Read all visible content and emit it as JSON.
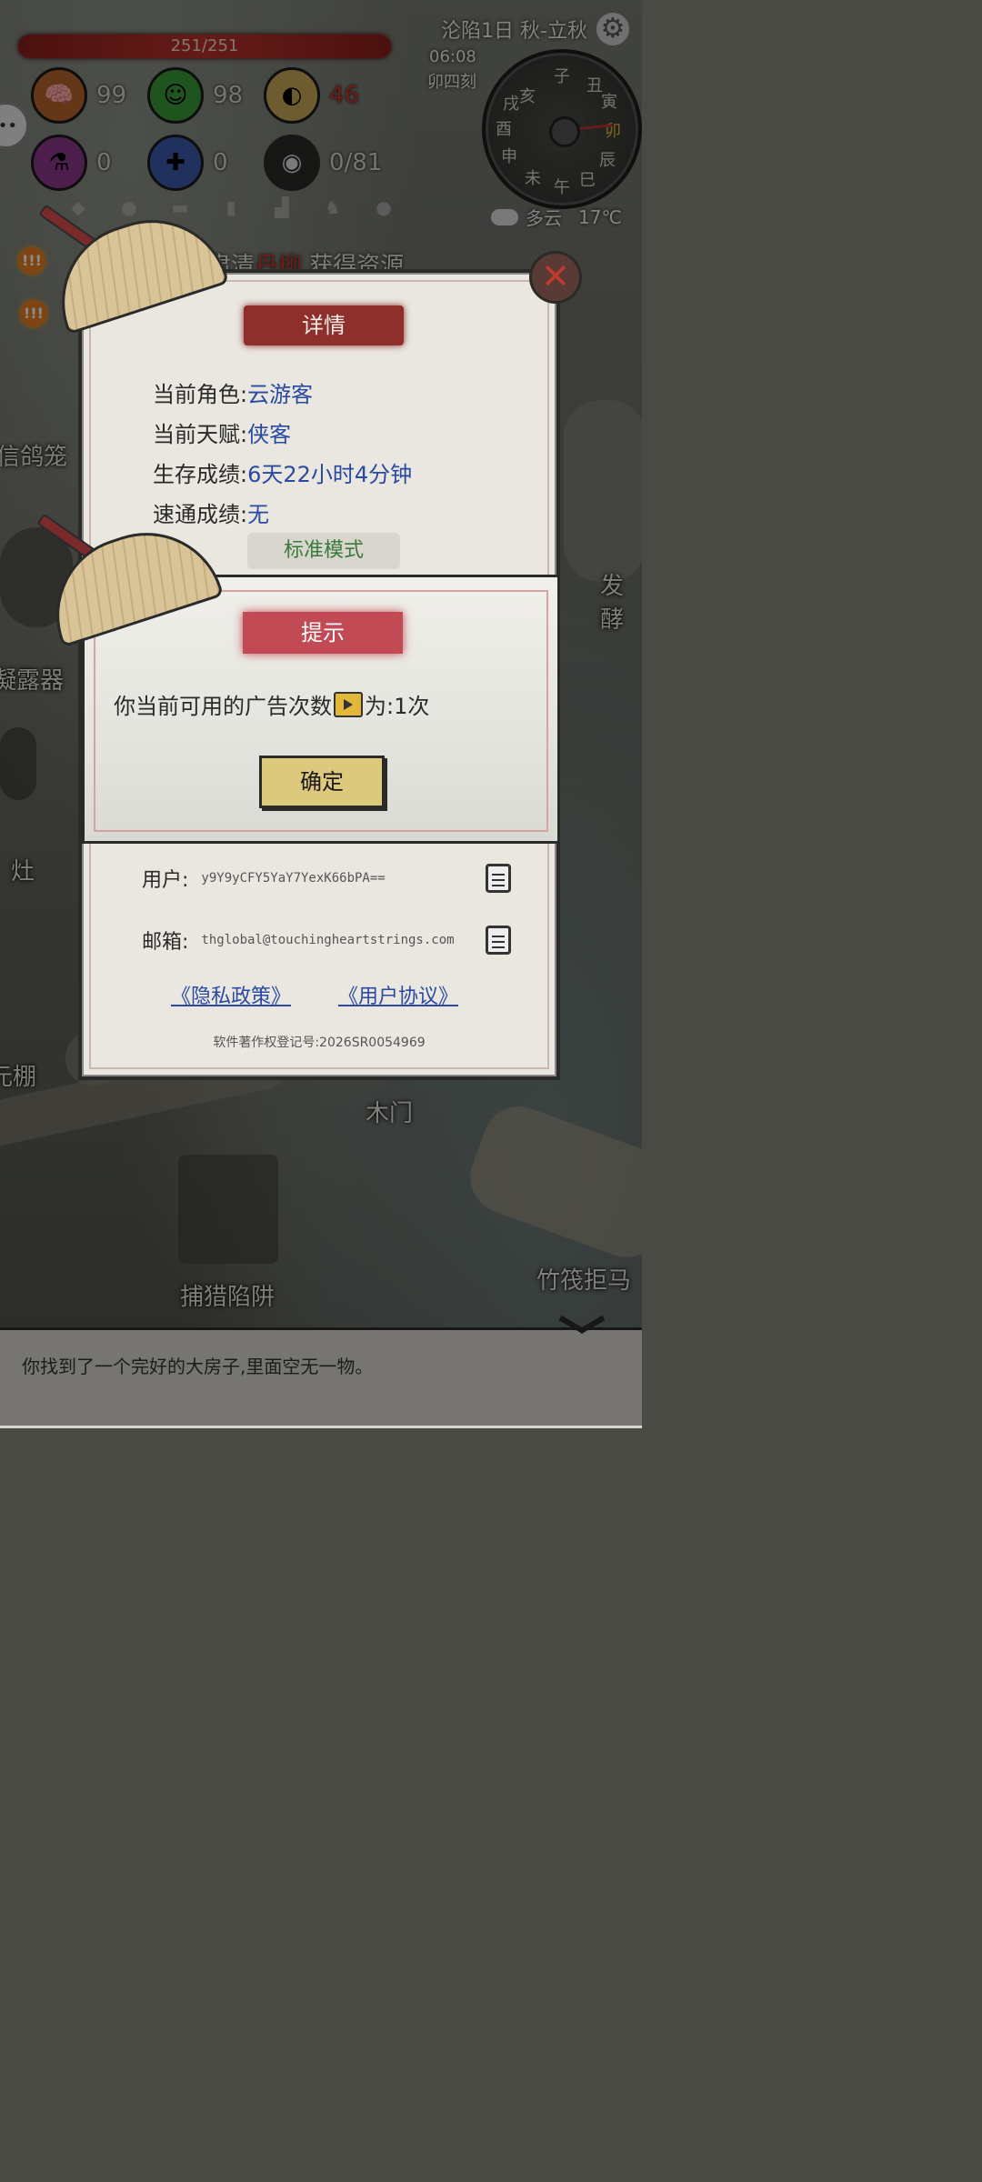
{
  "hud": {
    "hp": "251/251",
    "stats": [
      {
        "icon": "brain-icon",
        "value": "99"
      },
      {
        "icon": "smile-icon",
        "value": "98"
      },
      {
        "icon": "stomach-icon",
        "value": "46"
      },
      {
        "icon": "potion-icon",
        "value": "0"
      },
      {
        "icon": "bandage-icon",
        "value": "0"
      },
      {
        "icon": "bag-icon",
        "value": "0/81"
      }
    ],
    "date": "沦陷1日 秋-立秋",
    "time": "06:08",
    "ke": "卯四刻",
    "dial_hours": [
      "亥",
      "子",
      "丑",
      "寅",
      "卯",
      "辰",
      "巳",
      "午",
      "未",
      "申",
      "酉",
      "戌"
    ],
    "weather": "多云",
    "temperature": "17℃"
  },
  "task": {
    "prefix": "肃清",
    "highlight": "丹柳",
    "suffix": ",获得资源"
  },
  "scene_labels": [
    "信鸽笼",
    "凝露器",
    "灶",
    "元棚",
    "木门",
    "捕猎陷阱",
    "竹筏拒马",
    "发酵"
  ],
  "panel": {
    "title": "详情",
    "rows": [
      {
        "label": "当前角色:",
        "value": "云游客"
      },
      {
        "label": "当前天赋:",
        "value": "侠客"
      },
      {
        "label": "生存成绩:",
        "value": "6天22小时4分钟"
      },
      {
        "label": "速通成绩:",
        "value": "无"
      }
    ],
    "mode": "标准模式",
    "user_label": "用户:",
    "user_value": "y9Y9yCFY5YaY7YexK66bPA==",
    "email_label": "邮箱:",
    "email_value": "thglobal@touchingheartstrings.com",
    "privacy": "《隐私政策》",
    "agreement": "《用户协议》",
    "copyright": "软件著作权登记号:2026SR0054969"
  },
  "dialog": {
    "title": "提示",
    "msg_before": "你当前可用的广告次数",
    "msg_after": "为:1次",
    "ok": "确定"
  },
  "log": "你找到了一个完好的大房子,里面空无一物。",
  "colors": {
    "hp": "#b8322b",
    "accent_red": "#c24a55",
    "link": "#2a4aa0",
    "ok_button": "#dcc97e"
  }
}
